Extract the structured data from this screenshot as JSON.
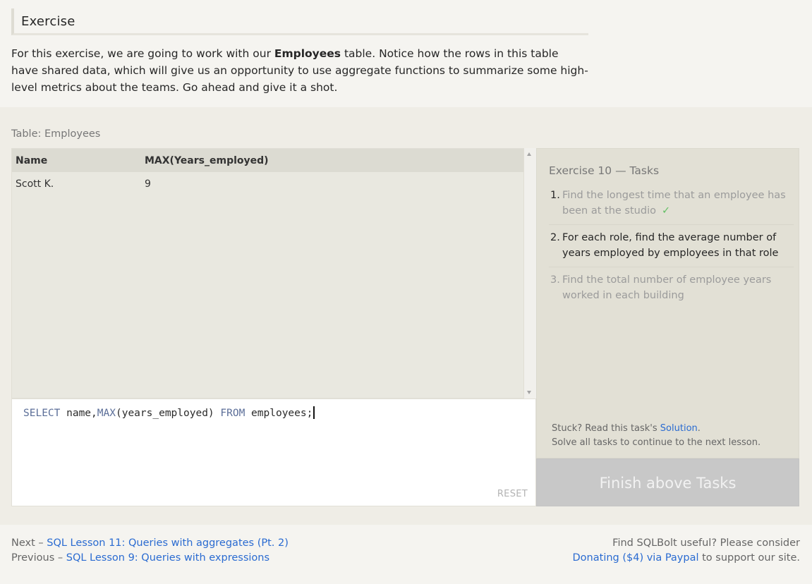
{
  "section": {
    "title": "Exercise"
  },
  "intro": {
    "before": "For this exercise, we are going to work with our ",
    "bold": "Employees",
    "after": " table. Notice how the rows in this table have shared data, which will give us an opportunity to use aggregate functions to summarize some high-level metrics about the teams. Go ahead and give it a shot."
  },
  "results": {
    "label": "Table: Employees",
    "columns": [
      "Name",
      "MAX(Years_employed)"
    ],
    "rows": [
      [
        "Scott K.",
        "9"
      ]
    ]
  },
  "editor": {
    "kw_select": "SELECT",
    "part1": " name,",
    "fn_max": "MAX",
    "part2": "(years_employed) ",
    "kw_from": "FROM",
    "part3": " employees;",
    "reset_label": "RESET"
  },
  "tasks": {
    "title": "Exercise 10 — Tasks",
    "items": [
      {
        "num": "1.",
        "text": "Find the longest time that an employee has been at the studio",
        "status": "done",
        "check": "✓"
      },
      {
        "num": "2.",
        "text": "For each role, find the average number of years employed by employees in that role",
        "status": "current"
      },
      {
        "num": "3.",
        "text": "Find the total number of employee years worked in each building",
        "status": "future"
      }
    ],
    "stuck_text": "Stuck? Read this task's ",
    "solution_link": "Solution",
    "stuck_end": ".",
    "solve_all": "Solve all tasks to continue to the next lesson.",
    "finish_label": "Finish above Tasks"
  },
  "footer": {
    "next_prefix": "Next – ",
    "next_link": "SQL Lesson 11: Queries with aggregates (Pt. 2)",
    "prev_prefix": "Previous – ",
    "prev_link": "SQL Lesson 9: Queries with expressions",
    "support_line1": "Find SQLBolt useful? Please consider",
    "donate_link": "Donating ($4) via Paypal",
    "support_end": " to support our site."
  },
  "colors": {
    "link": "#2a6bd1",
    "check": "#64c066",
    "keyword": "#5b6e98",
    "finish_bg": "#c8c8c8"
  }
}
